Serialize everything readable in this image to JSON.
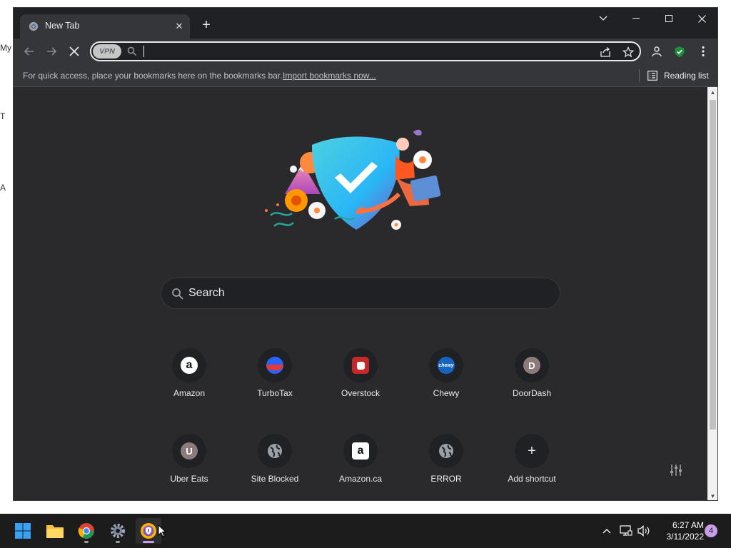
{
  "desktop": {
    "fragments": [
      "My",
      "T",
      "A"
    ]
  },
  "browser": {
    "tab": {
      "title": "New Tab"
    },
    "omnibox": {
      "value": "",
      "vpn_badge": "VPN"
    },
    "bookmarks_bar": {
      "hint": "For quick access, place your bookmarks here on the bookmarks bar.",
      "import_link": "Import bookmarks now...",
      "reading_list": "Reading list"
    },
    "ntp": {
      "search_placeholder": "Search",
      "shortcuts": [
        {
          "label": "Amazon",
          "icon": "amazon-icon",
          "letter": "a"
        },
        {
          "label": "TurboTax",
          "icon": "turbotax-icon",
          "letter": ""
        },
        {
          "label": "Overstock",
          "icon": "overstock-icon",
          "letter": ""
        },
        {
          "label": "Chewy",
          "icon": "chewy-icon",
          "letter": "chewy"
        },
        {
          "label": "DoorDash",
          "icon": "letter-icon",
          "letter": "D"
        },
        {
          "label": "Uber Eats",
          "icon": "letter-icon",
          "letter": "U"
        },
        {
          "label": "Site Blocked",
          "icon": "globe-icon",
          "letter": ""
        },
        {
          "label": "Amazon.ca",
          "icon": "amazon-icon",
          "letter": "a"
        },
        {
          "label": "ERROR",
          "icon": "globe-icon",
          "letter": ""
        },
        {
          "label": "Add shortcut",
          "icon": "plus-icon",
          "letter": "+"
        }
      ]
    }
  },
  "taskbar": {
    "time": "6:27 AM",
    "date": "3/11/2022",
    "notification_count": "4"
  },
  "colors": {
    "window_bg": "#202124",
    "toolbar_bg": "#35363a",
    "content_bg": "#2a2a2c",
    "text": "#e8eaed",
    "accent_purple": "#c89ee8"
  }
}
